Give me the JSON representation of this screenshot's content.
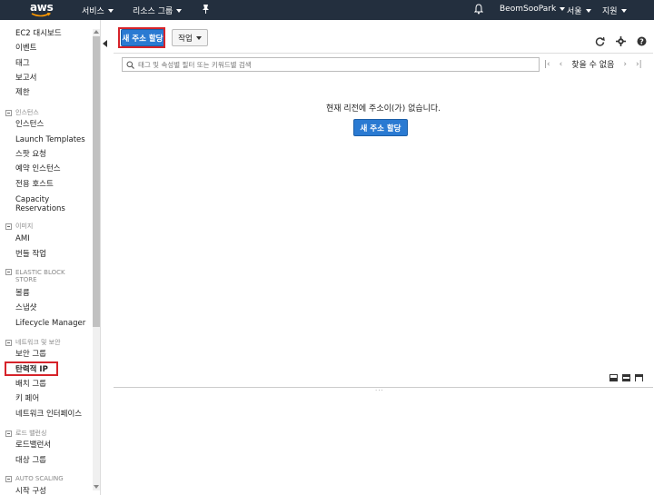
{
  "topnav": {
    "logo": "aws",
    "services": "서비스",
    "resource_groups": "리소스 그룹",
    "user": "BeomSooPark",
    "region": "서울",
    "support": "지원"
  },
  "sidebar": {
    "items_top": [
      "EC2 대시보드",
      "이벤트",
      "태그",
      "보고서",
      "제한"
    ],
    "group_instances": "인스턴스",
    "instances": [
      "인스턴스",
      "Launch Templates",
      "스팟 요청",
      "예약 인스턴스",
      "전용 호스트"
    ],
    "capacity_1": "Capacity",
    "capacity_2": "Reservations",
    "group_images": "이미지",
    "images": [
      "AMI",
      "번들 작업"
    ],
    "group_ebs_1": "ELASTIC BLOCK",
    "group_ebs_2": "STORE",
    "ebs": [
      "볼륨",
      "스냅샷",
      "Lifecycle Manager"
    ],
    "group_network": "네트워크 및 보안",
    "network": [
      "보안 그룹",
      "탄력적 IP",
      "배치 그룹",
      "키 페어",
      "네트워크 인터페이스"
    ],
    "group_lb": "로드 밸런싱",
    "lb": [
      "로드밸런서",
      "대상 그룹"
    ],
    "group_autoscaling": "AUTO SCALING",
    "autoscaling": [
      "시작 구성"
    ]
  },
  "main": {
    "allocate_button": "새 주소 할당",
    "actions_button": "작업",
    "search_placeholder": "태그 및 속성별 필터 또는 키워드별 검색",
    "pager_text": "찾을 수 없음",
    "empty_message": "현재 리전에 주소이(가) 없습니다.",
    "empty_allocate_button": "새 주소 할당"
  },
  "colors": {
    "nav_bg": "#232f3e",
    "primary": "#2a7ad2",
    "highlight": "#d6232a",
    "aws_orange": "#f90"
  }
}
